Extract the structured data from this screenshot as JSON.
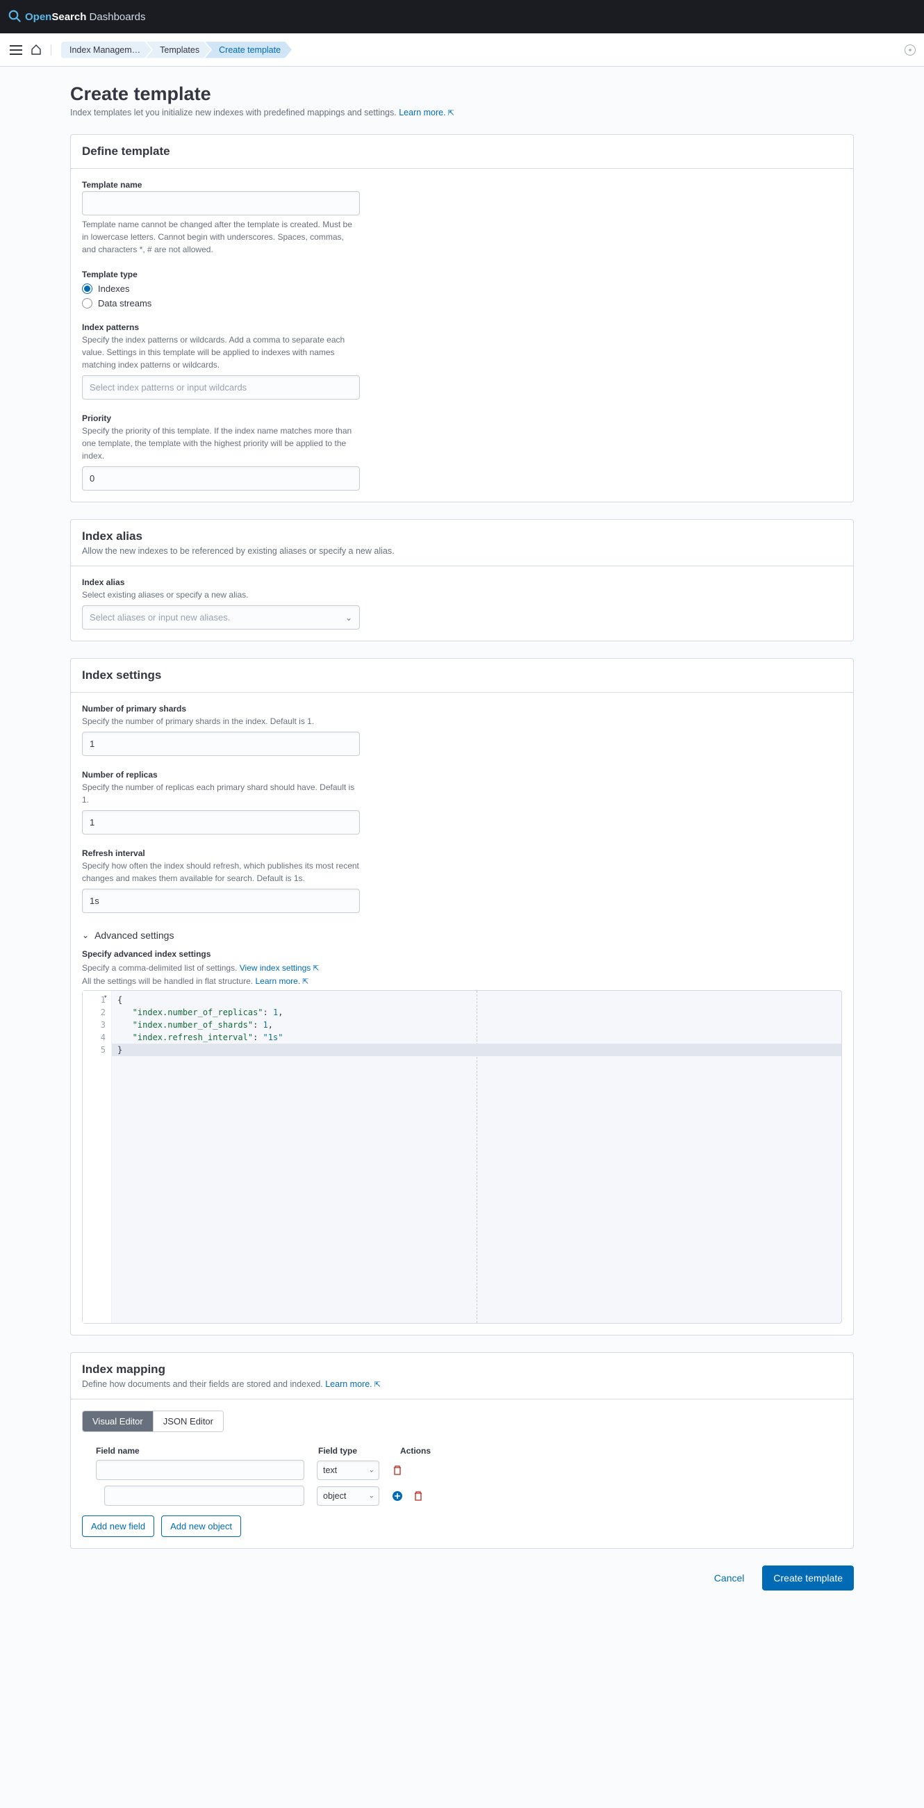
{
  "header": {
    "logo_open": "Open",
    "logo_search": "Search",
    "logo_dash": " Dashboards"
  },
  "breadcrumbs": [
    {
      "label": "Index Managem…"
    },
    {
      "label": "Templates"
    },
    {
      "label": "Create template"
    }
  ],
  "page": {
    "title": "Create template",
    "subtitle": "Index templates let you initialize new indexes with predefined mappings and settings. ",
    "learn_more": "Learn more."
  },
  "define": {
    "title": "Define template",
    "name_label": "Template name",
    "name_help": "Template name cannot be changed after the template is created. Must be in lowercase letters. Cannot begin with underscores. Spaces, commas, and characters *, # are not allowed.",
    "type_label": "Template type",
    "type_options": [
      {
        "label": "Indexes",
        "checked": true
      },
      {
        "label": "Data streams",
        "checked": false
      }
    ],
    "patterns_label": "Index patterns",
    "patterns_help": "Specify the index patterns or wildcards. Add a comma to separate each value. Settings in this template will be applied to indexes with names matching index patterns or wildcards.",
    "patterns_placeholder": "Select index patterns or input wildcards",
    "priority_label": "Priority",
    "priority_help": "Specify the priority of this template. If the index name matches more than one template, the template with the highest priority will be applied to the index.",
    "priority_value": "0"
  },
  "alias": {
    "title": "Index alias",
    "subtitle": "Allow the new indexes to be referenced by existing aliases or specify a new alias.",
    "field_label": "Index alias",
    "field_help": "Select existing aliases or specify a new alias.",
    "placeholder": "Select aliases or input new aliases."
  },
  "settings": {
    "title": "Index settings",
    "shards_label": "Number of primary shards",
    "shards_help": "Specify the number of primary shards in the index. Default is 1.",
    "shards_value": "1",
    "replicas_label": "Number of replicas",
    "replicas_help": "Specify the number of replicas each primary shard should have. Default is 1.",
    "replicas_value": "1",
    "refresh_label": "Refresh interval",
    "refresh_help": "Specify how often the index should refresh, which publishes its most recent changes and makes them available for search. Default is 1s.",
    "refresh_value": "1s",
    "advanced_toggle": "Advanced settings",
    "advanced_title": "Specify advanced index settings",
    "advanced_help": "Specify a comma-delimited list of settings. ",
    "view_settings": "View index settings",
    "advanced_help2": "All the settings will be handled in flat structure. ",
    "learn_more": "Learn more.",
    "code_lines": [
      "1",
      "2",
      "3",
      "4",
      "5"
    ],
    "code_content": {
      "l1": "{",
      "l2a": "   \"index.number_of_replicas\"",
      "l2b": ": ",
      "l2c": "1",
      "l2d": ",",
      "l3a": "   \"index.number_of_shards\"",
      "l3b": ": ",
      "l3c": "1",
      "l3d": ",",
      "l4a": "   \"index.refresh_interval\"",
      "l4b": ": ",
      "l4c": "\"1s\"",
      "l5": "}"
    }
  },
  "mapping": {
    "title": "Index mapping",
    "subtitle": "Define how documents and their fields are stored and indexed. ",
    "learn_more": "Learn more.",
    "tabs": [
      {
        "label": "Visual Editor",
        "active": true
      },
      {
        "label": "JSON Editor",
        "active": false
      }
    ],
    "headers": {
      "name": "Field name",
      "type": "Field type",
      "actions": "Actions"
    },
    "rows": [
      {
        "name": "",
        "type": "text",
        "nested": false,
        "plus": false
      },
      {
        "name": "",
        "type": "object",
        "nested": true,
        "plus": true
      }
    ],
    "add_field": "Add new field",
    "add_object": "Add new object"
  },
  "footer": {
    "cancel": "Cancel",
    "create": "Create template"
  }
}
